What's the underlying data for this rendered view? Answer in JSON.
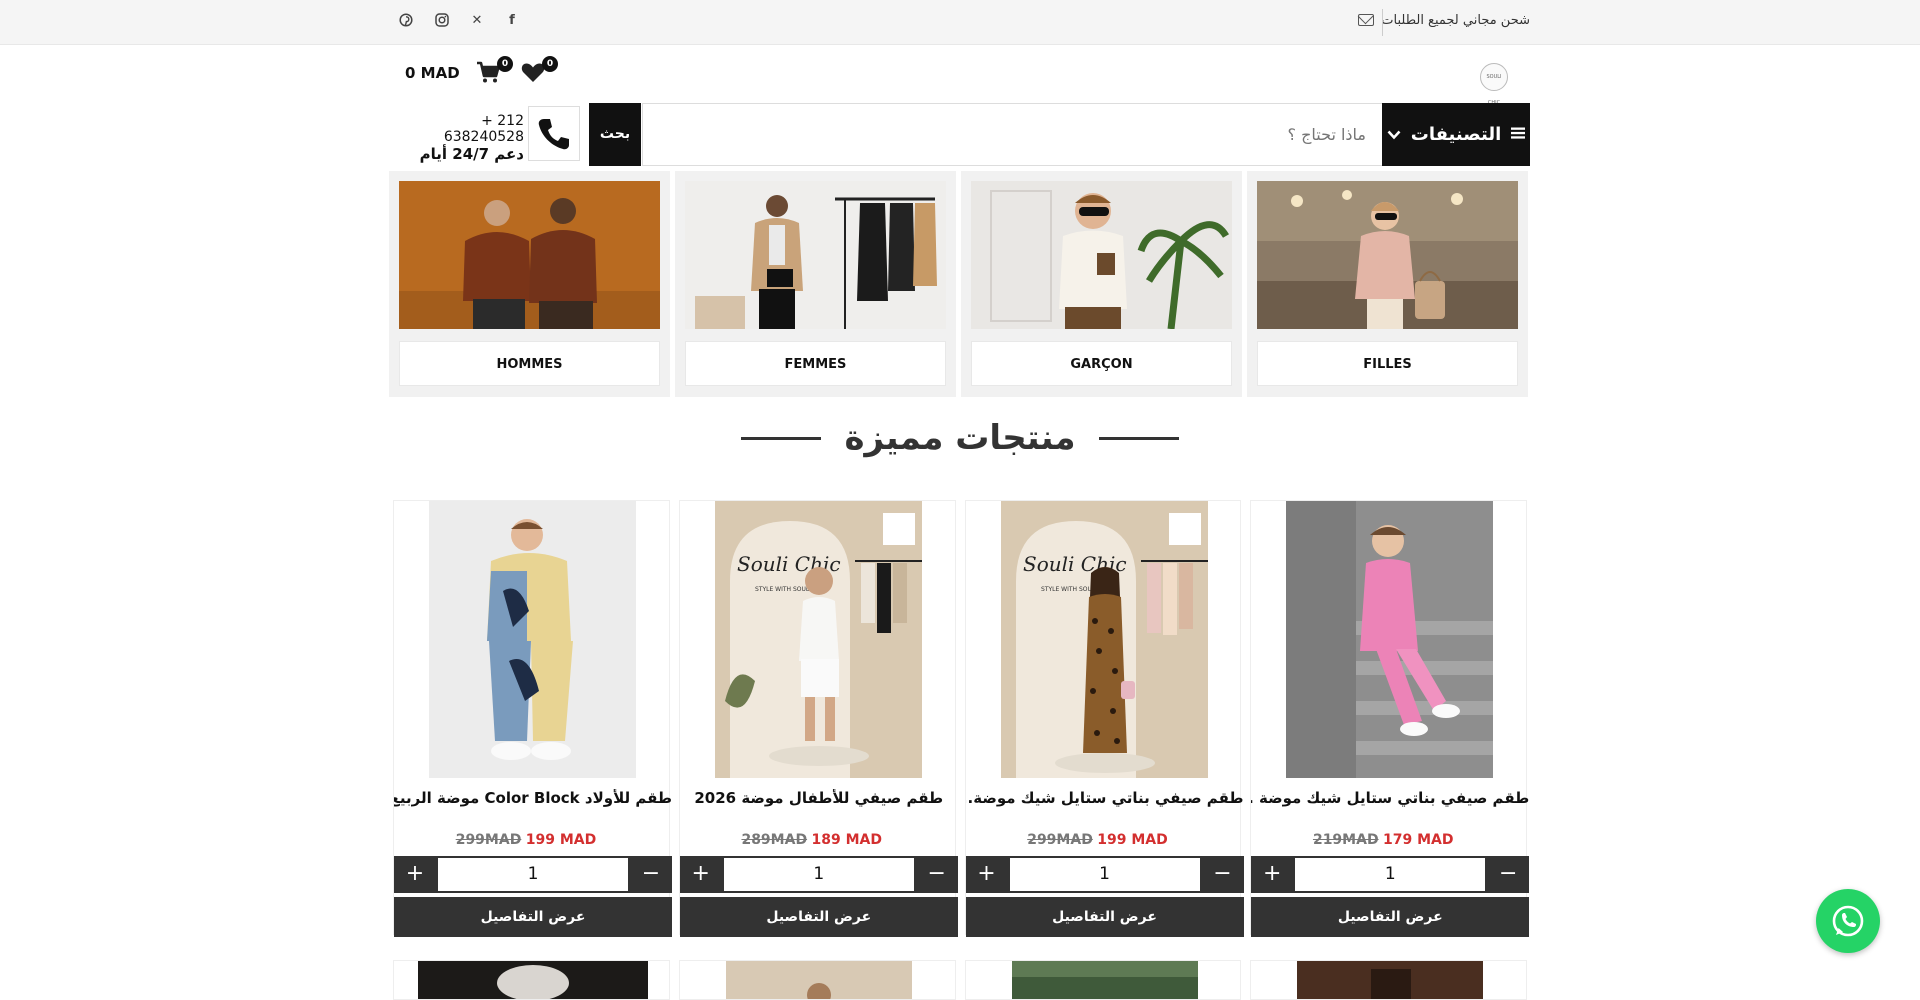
{
  "topbar": {
    "promo": "شحن مجاني لجميع الطلبات",
    "icons": [
      "mail-icon",
      "facebook-icon",
      "x-icon",
      "instagram-icon",
      "pinterest-icon"
    ]
  },
  "header": {
    "logo_text": "SOULI CHIC",
    "cart_total": "0 MAD",
    "cart_count": "0",
    "wishlist_count": "0"
  },
  "search": {
    "categories_label": "التصنيفات",
    "placeholder": "ماذا تحتاج ؟",
    "button_label": "بحث",
    "phone": "+ 212 638240528",
    "support": "دعم 24/7 أيام"
  },
  "categories": [
    {
      "label": "HOMMES"
    },
    {
      "label": "FEMMES"
    },
    {
      "label": "GARÇON"
    },
    {
      "label": "FILLES"
    }
  ],
  "featured": {
    "title": "منتجات مميزة",
    "details_label": "عرض التفاصيل",
    "products": [
      {
        "title": "طقم للأولاد Color Block موضة الربيع..",
        "price": "199 MAD",
        "old_price": "299MAD",
        "qty": "1"
      },
      {
        "title": "طقم صيفي للأطفال موضة 2026",
        "price": "189 MAD",
        "old_price": "289MAD",
        "qty": "1"
      },
      {
        "title": "طقم صيفي بناتي ستايل شيك موضة..",
        "price": "199 MAD",
        "old_price": "299MAD",
        "qty": "1"
      },
      {
        "title": "طقم صيفي بناتي ستايل شيك موضة ..",
        "price": "179 MAD",
        "old_price": "219MAD",
        "qty": "1"
      }
    ]
  },
  "colors": {
    "primary": "#111111",
    "button_dark": "#333333",
    "sale_red": "#d32f2f",
    "whatsapp": "#25d366"
  }
}
